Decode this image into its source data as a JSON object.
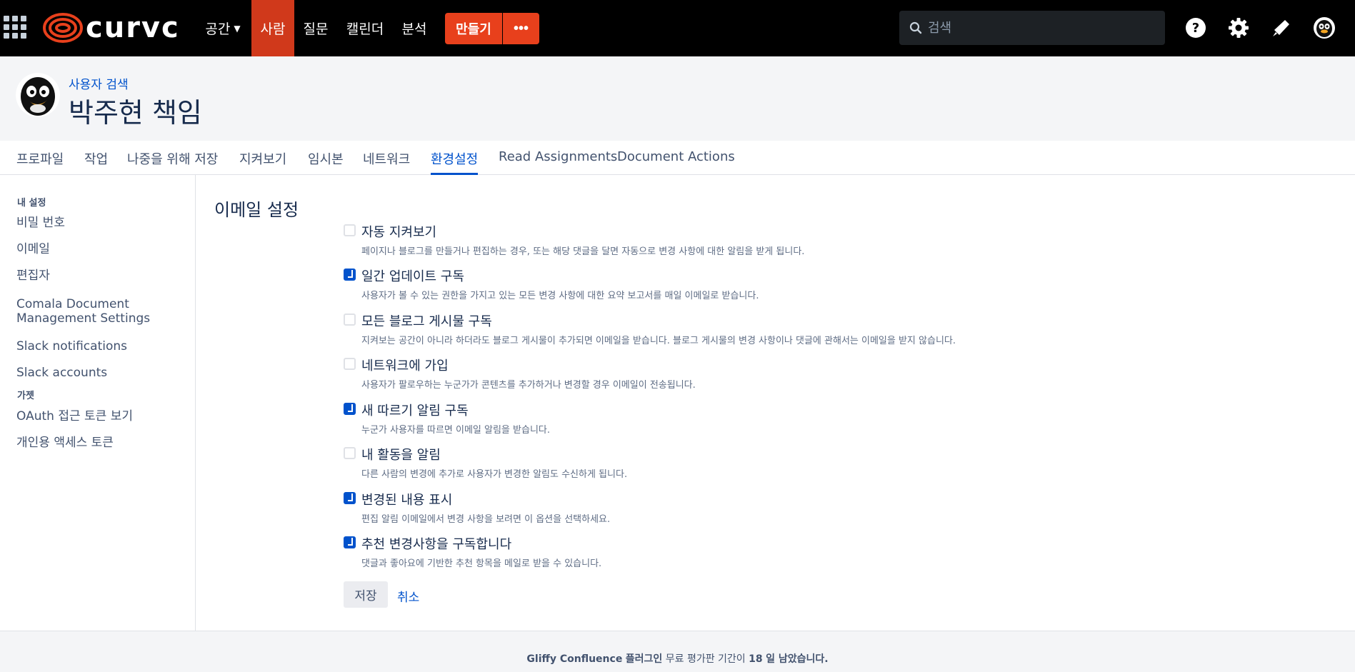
{
  "topnav": {
    "logo_text": "curvc",
    "items": [
      {
        "label": "공간",
        "has_dropdown": true
      },
      {
        "label": "사람",
        "active": true
      },
      {
        "label": "질문"
      },
      {
        "label": "캘린더"
      },
      {
        "label": "분석"
      }
    ],
    "create_label": "만들기",
    "more_label": "•••",
    "search_placeholder": "검색",
    "accent_color": "#e8401c",
    "icons": [
      "help-icon",
      "settings-gear-icon",
      "notifications-megaphone-icon",
      "user-avatar-icon"
    ]
  },
  "header": {
    "breadcrumb": "사용자 검색",
    "title": "박주현 책임"
  },
  "tabs": [
    {
      "label": "프로파일"
    },
    {
      "label": "작업"
    },
    {
      "label": "나중을 위해 저장"
    },
    {
      "label": "지켜보기"
    },
    {
      "label": "임시본"
    },
    {
      "label": "네트워크"
    },
    {
      "label": "환경설정",
      "active": true
    },
    {
      "label": "Read Assignments"
    },
    {
      "label": "Document Actions"
    }
  ],
  "sidebar": {
    "heading1": "내 설정",
    "items1": [
      {
        "label": "비밀 번호"
      },
      {
        "label": "이메일"
      },
      {
        "label": "편집자"
      },
      {
        "label": "Comala Document Management Settings"
      },
      {
        "label": "Slack notifications"
      },
      {
        "label": "Slack accounts"
      }
    ],
    "heading2": "가젯",
    "items2": [
      {
        "label": "OAuth 접근 토큰 보기"
      },
      {
        "label": "개인용 액세스 토큰"
      }
    ]
  },
  "main": {
    "section_title": "이메일 설정",
    "options": [
      {
        "label": "자동 지켜보기",
        "checked": false,
        "desc": "페이지나 블로그를 만들거나 편집하는 경우, 또는 해당 댓글을 달면 자동으로 변경 사항에 대한 알림을 받게 됩니다."
      },
      {
        "label": "일간 업데이트 구독",
        "checked": true,
        "desc": "사용자가 볼 수 있는 권한을 가지고 있는 모든 변경 사항에 대한 요약 보고서를 매일 이메일로 받습니다."
      },
      {
        "label": "모든 블로그 게시물 구독",
        "checked": false,
        "desc": "지켜보는 공간이 아니라 하더라도 블로그 게시물이 추가되면 이메일을 받습니다. 블로그 게시물의 변경 사항이나 댓글에 관해서는 이메일을 받지 않습니다."
      },
      {
        "label": "네트워크에 가입",
        "checked": false,
        "desc": "사용자가 팔로우하는 누군가가 콘텐츠를 추가하거나 변경할 경우 이메일이 전송됩니다."
      },
      {
        "label": "새 따르기 알림 구독",
        "checked": true,
        "desc": "누군가 사용자를 따르면 이메일 알림을 받습니다."
      },
      {
        "label": "내 활동을 알림",
        "checked": false,
        "desc": "다른 사람의 변경에 추가로 사용자가 변경한 알림도 수신하게 됩니다."
      },
      {
        "label": "변경된 내용 표시",
        "checked": true,
        "desc": "편집 알림 이메일에서 변경 사항을 보려면 이 옵션을 선택하세요."
      },
      {
        "label": "추천 변경사항을 구독합니다",
        "checked": true,
        "desc": "댓글과 좋아요에 기반한 추천 항목을 메일로 받을 수 있습니다."
      }
    ],
    "save_label": "저장",
    "cancel_label": "취소"
  },
  "footer": {
    "plugin": "Gliffy Confluence",
    "plugin_suffix": "플러그인",
    "middle": "무료 평가판 기간이",
    "days": "18",
    "end": "일 남았습니다."
  }
}
